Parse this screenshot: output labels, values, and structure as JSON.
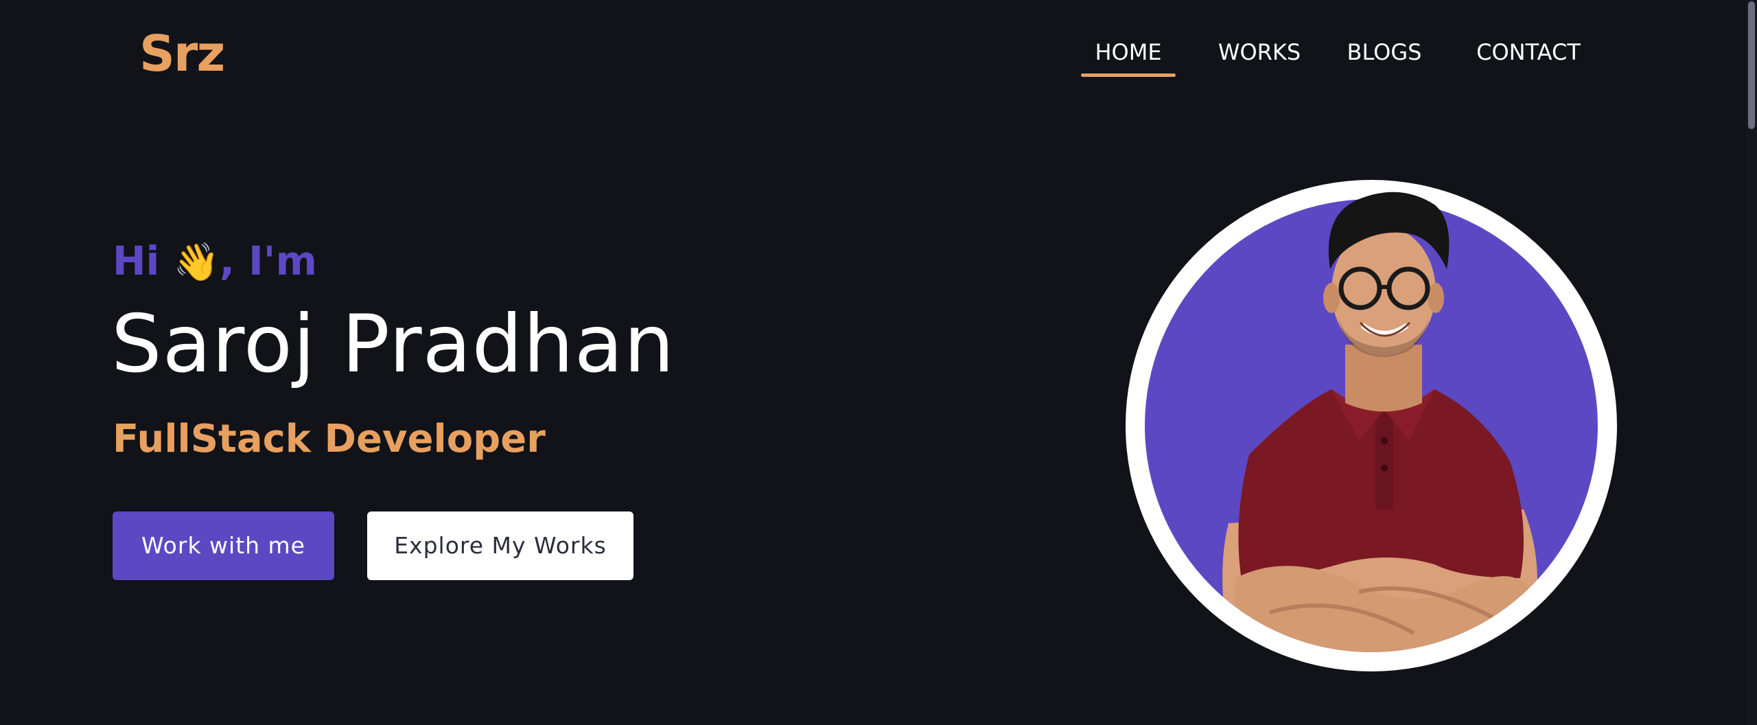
{
  "brand": {
    "logo_text": "Srz",
    "accent_color": "#e8a060",
    "primary_color": "#5d48c4",
    "background_color": "#111319"
  },
  "nav": {
    "items": [
      {
        "label": "HOME",
        "active": true
      },
      {
        "label": "WORKS",
        "active": false
      },
      {
        "label": "BLOGS",
        "active": false
      },
      {
        "label": "CONTACT",
        "active": false
      }
    ]
  },
  "hero": {
    "greeting_prefix": "Hi ",
    "greeting_emoji": "👋",
    "greeting_suffix": ", I'm",
    "name": "Saroj Pradhan",
    "role": "FullStack Developer",
    "primary_cta": "Work with me",
    "secondary_cta": "Explore My Works"
  },
  "profile": {
    "icon": "profile-photo-icon"
  }
}
